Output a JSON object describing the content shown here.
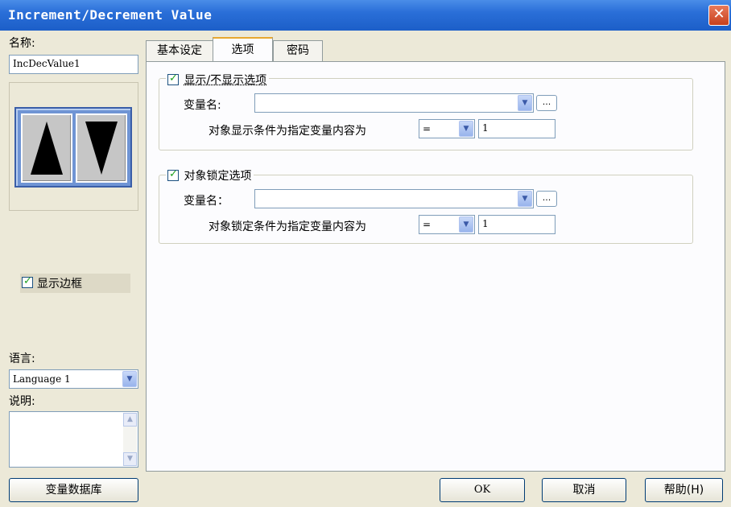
{
  "window": {
    "title": "Increment/Decrement Value",
    "close_symbol": "✕"
  },
  "left": {
    "name_label": "名称:",
    "name_value": "IncDecValue1",
    "show_border_label": "显示边框",
    "show_border_checked": true,
    "language_label": "语言:",
    "language_value": "Language 1",
    "description_label": "说明:",
    "var_db_button": "变量数据库"
  },
  "tabs": [
    {
      "label": "基本设定",
      "active": false
    },
    {
      "label": "选项",
      "active": true
    },
    {
      "label": "密码",
      "active": false
    }
  ],
  "show_group": {
    "title": "显示/不显示选项",
    "checked": true,
    "var_label": "变量名:",
    "var_value": "",
    "browse_label": "...",
    "condition_label": "对象显示条件为指定变量内容为",
    "op_value": "=",
    "cond_value": "1"
  },
  "lock_group": {
    "title": "对象锁定选项",
    "checked": true,
    "var_label": "变量名：",
    "var_value": "",
    "browse_label": "...",
    "condition_label": "对象锁定条件为指定变量内容为",
    "op_value": "=",
    "cond_value": "1"
  },
  "buttons": {
    "ok": "OK",
    "cancel": "取消",
    "help": "帮助(H)"
  },
  "colors": {
    "titlebar": "#2a6fd8",
    "window_bg": "#ece9d8",
    "check_green": "#21a121",
    "tab_highlight": "#e8a830"
  }
}
